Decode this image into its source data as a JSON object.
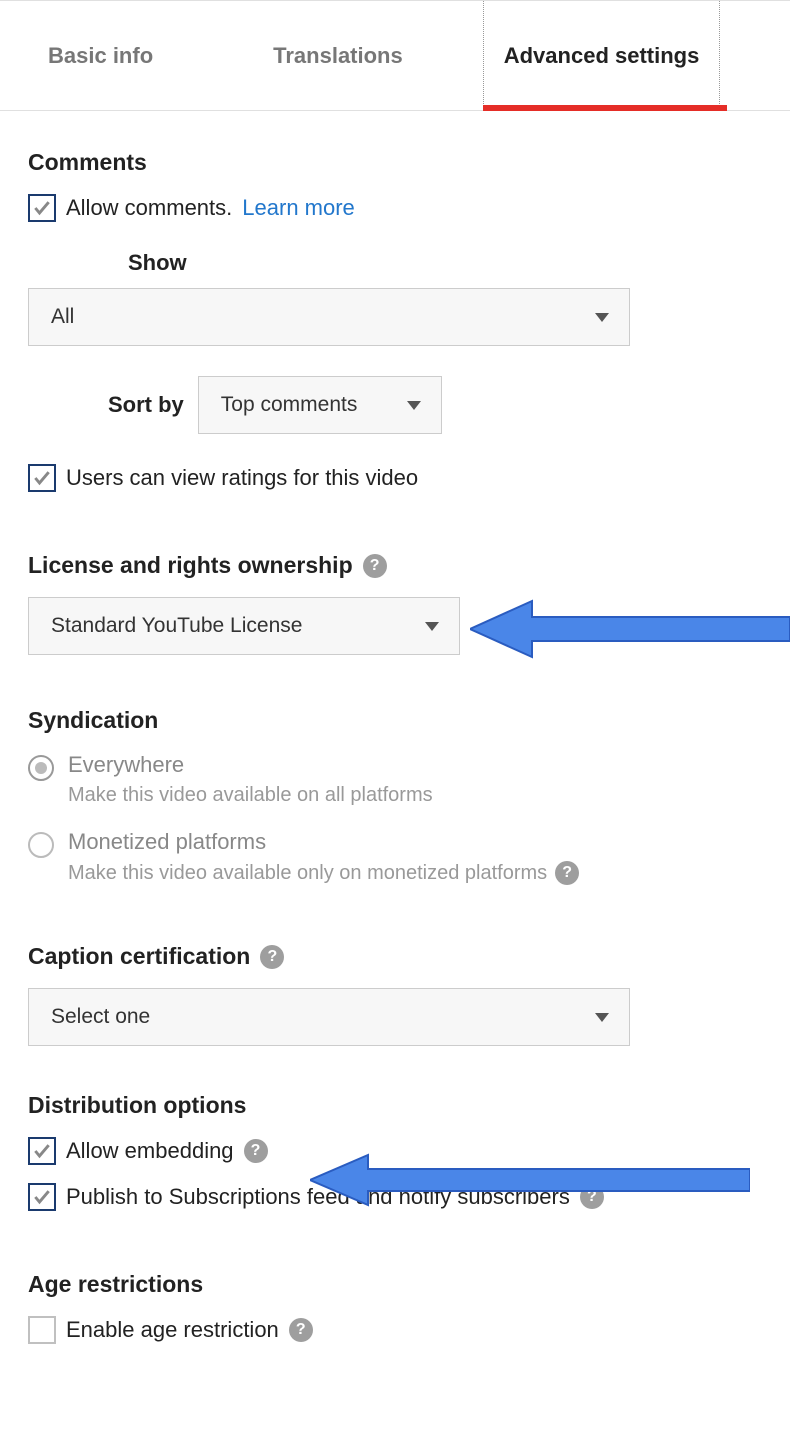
{
  "tabs": {
    "basic": "Basic info",
    "translations": "Translations",
    "advanced": "Advanced settings"
  },
  "comments": {
    "heading": "Comments",
    "allow_label": "Allow comments.",
    "learn_more": "Learn more",
    "show_label": "Show",
    "show_value": "All",
    "sort_label": "Sort by",
    "sort_value": "Top comments",
    "ratings_label": "Users can view ratings for this video"
  },
  "license": {
    "heading": "License and rights ownership",
    "value": "Standard YouTube License"
  },
  "syndication": {
    "heading": "Syndication",
    "opt1_label": "Everywhere",
    "opt1_sub": "Make this video available on all platforms",
    "opt2_label": "Monetized platforms",
    "opt2_sub": "Make this video available only on monetized platforms"
  },
  "caption": {
    "heading": "Caption certification",
    "value": "Select one"
  },
  "distribution": {
    "heading": "Distribution options",
    "embed_label": "Allow embedding",
    "publish_label": "Publish to Subscriptions feed and notify subscribers"
  },
  "age": {
    "heading": "Age restrictions",
    "enable_label": "Enable age restriction"
  },
  "help_glyph": "?"
}
